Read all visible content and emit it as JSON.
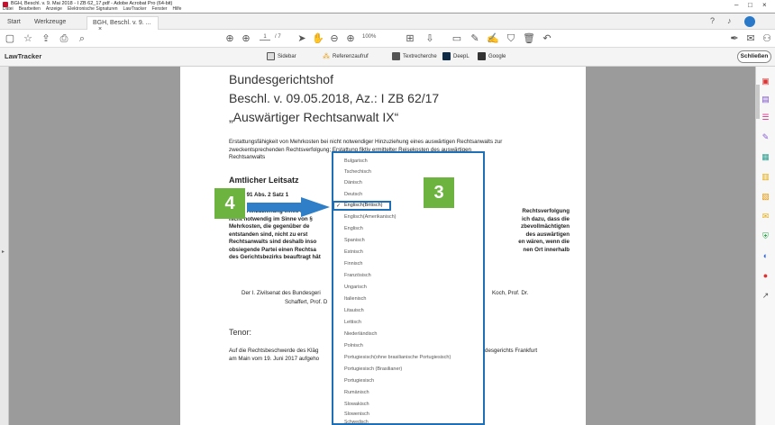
{
  "window": {
    "title": "BGH, Beschl. v. 9. Mai 2018 - I ZB 62_17.pdf - Adobe Acrobat Pro (64-bit)",
    "controls": [
      "–",
      "□",
      "×"
    ]
  },
  "menu": [
    "Datei",
    "Bearbeiten",
    "Anzeige",
    "Elektronische Signaturen",
    "LawTracker",
    "Fenster",
    "Hilfe"
  ],
  "tabs": [
    {
      "label": "Start"
    },
    {
      "label": "Werkzeuge"
    },
    {
      "label": "BGH, Beschl. v. 9. ...",
      "close": "×"
    }
  ],
  "toolbar": {
    "page_current": "1",
    "page_total": "/ 7",
    "zoom": "100%"
  },
  "lawtracker": {
    "brand": "LawTracker",
    "buttons": [
      {
        "label": "Sidebar"
      },
      {
        "label": "Referenzaufruf"
      },
      {
        "label": "Textrecherche"
      },
      {
        "label": "DeepL"
      },
      {
        "label": "Google"
      }
    ],
    "close_label": "Schließen"
  },
  "document": {
    "court": "Bundesgerichtshof",
    "case": "Beschl. v. 09.05.2018, Az.: I ZB 62/17",
    "name": "„Auswärtiger Rechtsanwalt IX“",
    "intro_lines": [
      "Erstattungsfähigkeit von Mehrkosten bei nicht notwendiger Hinzuziehung eines auswärtigen Rechtsanwalts zur",
      "zweckentsprechenden Rechtsverfolgung; Erstattung fiktiv ermittelter Reisekosten des auswärtigen",
      "Rechtsanwalts"
    ],
    "section_title": "Amtlicher Leitsatz",
    "para_label": "ZPO § 91 Abs. 2 Satz 1",
    "leitsatz_left": [
      "Ist die Hinzuziehung eines ausw",
      "nicht notwendig im Sinne von §",
      "Mehrkosten, die gegenüber de",
      "entstanden sind, nicht zu erst",
      "Rechtsanwalts sind deshalb inso",
      "obsiegende Partei einen Rechtsa",
      "des Gerichtsbezirks beauftragt hät"
    ],
    "leitsatz_right": [
      "Rechtsverfolgung",
      "ich dazu, dass die",
      "zbevollmächtigten",
      "des auswärtigen",
      "en wären, wenn die",
      "nen Ort innerhalb",
      ""
    ],
    "senate_left": "Der I. Zivilsenat des Bundesgeri",
    "senate_left2": "Schaffert, Prof. D",
    "senate_right": "Koch, Prof. Dr.",
    "tenor_title": "Tenor:",
    "tenor_left": "Auf die Rechtsbeschwerde des Kläg",
    "tenor_left2": "am Main vom 19. Juni 2017 aufgeho",
    "tenor_right": "desgerichts Frankfurt"
  },
  "language_dropdown": {
    "items": [
      "Bulgarisch",
      "Tschechisch",
      "Dänisch",
      "Deutsch",
      "Englisch(Britisch)",
      "Englisch(Amerikanisch)",
      "Englisch",
      "Spanisch",
      "Estnisch",
      "Finnisch",
      "Französisch",
      "Ungarisch",
      "Italienisch",
      "Litauisch",
      "Lettisch",
      "Niederländisch",
      "Polnisch",
      "Portugiesisch(ohne brasilianische Portugiesisch)",
      "Portugiesisch (Brasilianer)",
      "Portugiesisch",
      "Rumänisch",
      "Slowakisch",
      "Slowenisch",
      "Schwedisch"
    ],
    "selected": "Englisch(Britisch)"
  },
  "annotations": {
    "badge_3": "3",
    "badge_4": "4"
  },
  "colors": {
    "badge": "#6db33f",
    "highlight": "#1e6fb5",
    "arrow": "#2e7fc8"
  }
}
